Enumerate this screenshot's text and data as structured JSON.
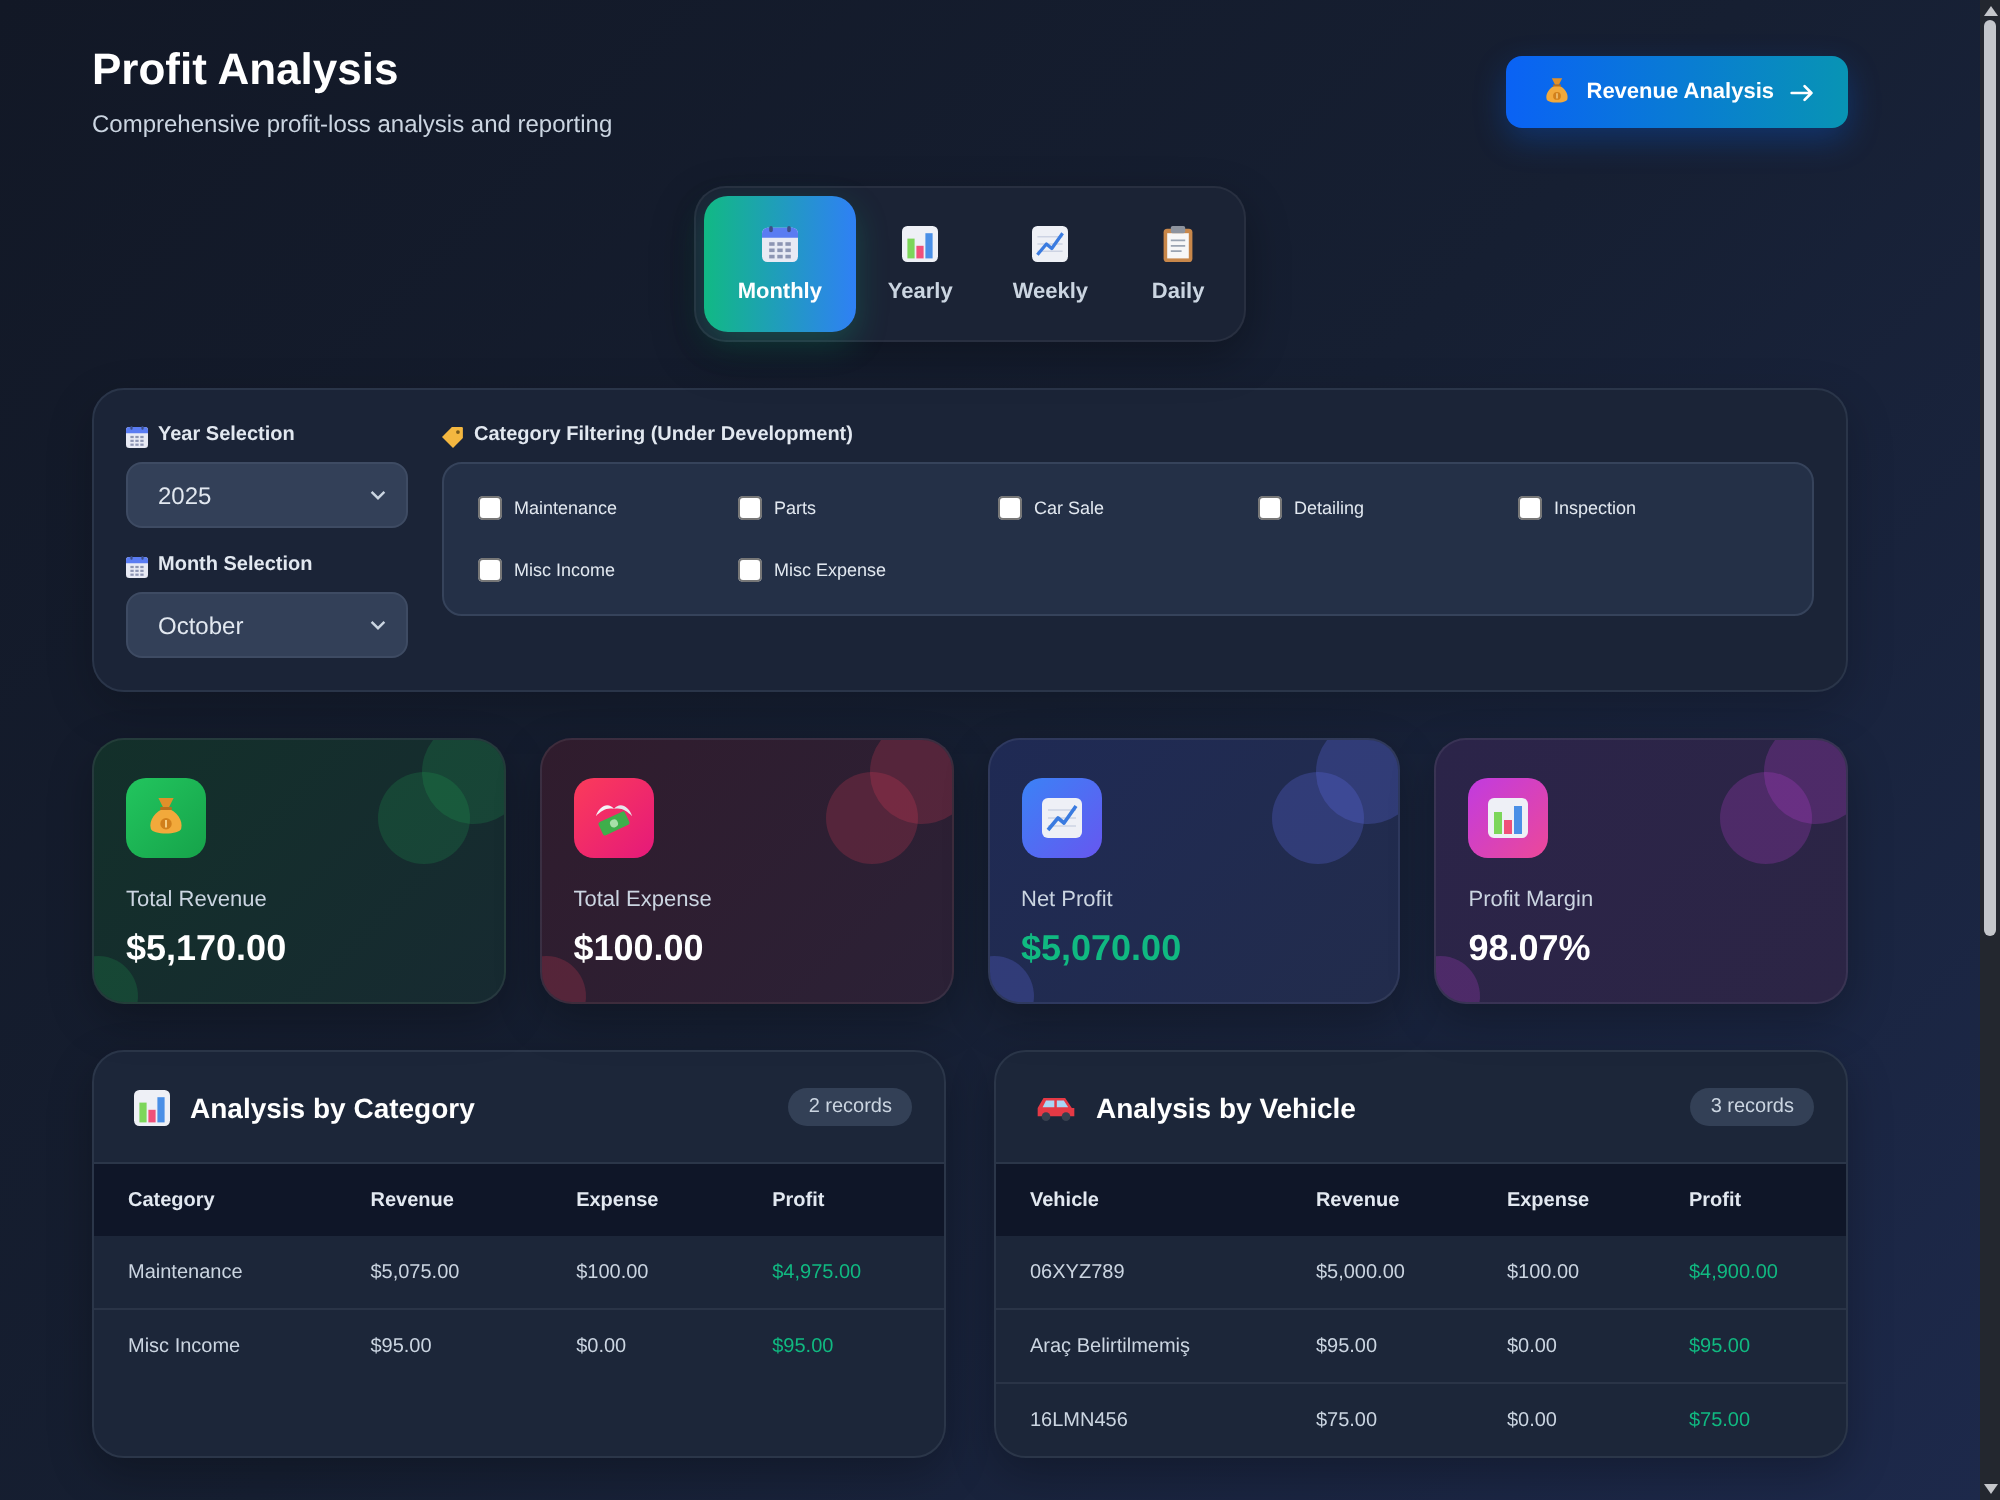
{
  "header": {
    "title": "Profit Analysis",
    "subtitle": "Comprehensive profit-loss analysis and reporting",
    "action_button": "Revenue Analysis"
  },
  "period_tabs": [
    {
      "label": "Monthly",
      "selected": true
    },
    {
      "label": "Yearly",
      "selected": false
    },
    {
      "label": "Weekly",
      "selected": false
    },
    {
      "label": "Daily",
      "selected": false
    }
  ],
  "filters": {
    "year": {
      "label": "Year Selection",
      "value": "2025"
    },
    "month": {
      "label": "Month Selection",
      "value": "October"
    },
    "category_filter": {
      "label": "Category Filtering (Under Development)",
      "options": [
        {
          "label": "Maintenance",
          "checked": false
        },
        {
          "label": "Parts",
          "checked": false
        },
        {
          "label": "Car Sale",
          "checked": false
        },
        {
          "label": "Detailing",
          "checked": false
        },
        {
          "label": "Inspection",
          "checked": false
        },
        {
          "label": "Misc Income",
          "checked": false
        },
        {
          "label": "Misc Expense",
          "checked": false
        }
      ]
    }
  },
  "stats": [
    {
      "kind": "revenue",
      "label": "Total Revenue",
      "value": "$5,170.00"
    },
    {
      "kind": "expense",
      "label": "Total Expense",
      "value": "$100.00"
    },
    {
      "kind": "profit",
      "label": "Net Profit",
      "value": "$5,070.00"
    },
    {
      "kind": "margin",
      "label": "Profit Margin",
      "value": "98.07%"
    }
  ],
  "tables": [
    {
      "title": "Analysis by Category",
      "count": "2 records",
      "columns": [
        "Category",
        "Revenue",
        "Expense",
        "Profit"
      ],
      "rows": [
        [
          "Maintenance",
          "$5,075.00",
          "$100.00",
          "$4,975.00"
        ],
        [
          "Misc Income",
          "$95.00",
          "$0.00",
          "$95.00"
        ]
      ]
    },
    {
      "title": "Analysis by Vehicle",
      "count": "3 records",
      "columns": [
        "Vehicle",
        "Revenue",
        "Expense",
        "Profit"
      ],
      "rows": [
        [
          "06XYZ789",
          "$5,000.00",
          "$100.00",
          "$4,900.00"
        ],
        [
          "Araç Belirtilmemiş",
          "$95.00",
          "$0.00",
          "$95.00"
        ],
        [
          "16LMN456",
          "$75.00",
          "$0.00",
          "$75.00"
        ]
      ]
    }
  ]
}
